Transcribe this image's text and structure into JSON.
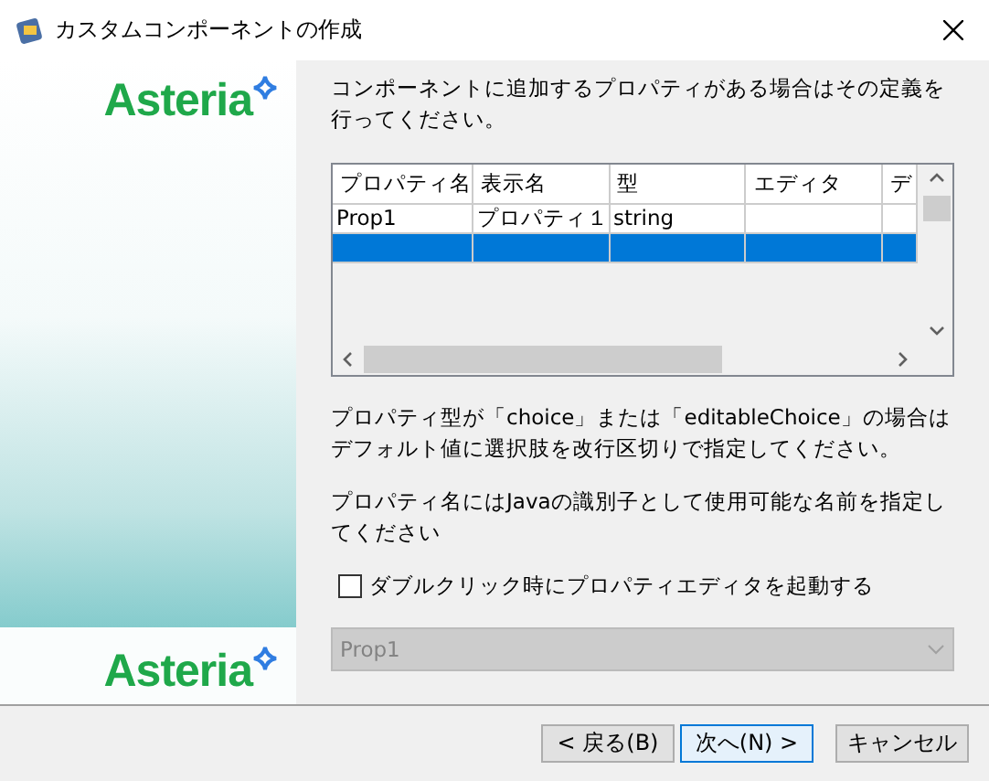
{
  "window": {
    "title": "カスタムコンポーネントの作成"
  },
  "brand": {
    "top_logo": "Asteria",
    "bottom_logo": "Asteria"
  },
  "intro": "コンポーネントに追加するプロパティがある場合はその定義を行ってください。",
  "table": {
    "columns": [
      "プロパティ名",
      "表示名",
      "型",
      "エディタ",
      "デ"
    ],
    "rows": [
      {
        "cells": [
          "Prop1",
          "プロパティ１",
          "string"
        ],
        "selected": false
      },
      {
        "selected": true
      }
    ]
  },
  "notes": [
    "プロパティ型が「choice」または「editableChoice」の場合はデフォルト値に選択肢を改行区切りで指定してください。",
    "プロパティ名にはJavaの識別子として使用可能な名前を指定してください"
  ],
  "checkbox": {
    "label": "ダブルクリック時にプロパティエディタを起動する",
    "checked": false
  },
  "combo": {
    "value": "Prop1",
    "disabled": true
  },
  "buttons": [
    {
      "label": "< 戻る(B)",
      "default": false
    },
    {
      "label": "次へ(N) >",
      "default": true
    },
    {
      "label": "キャンセル",
      "default": false
    }
  ]
}
